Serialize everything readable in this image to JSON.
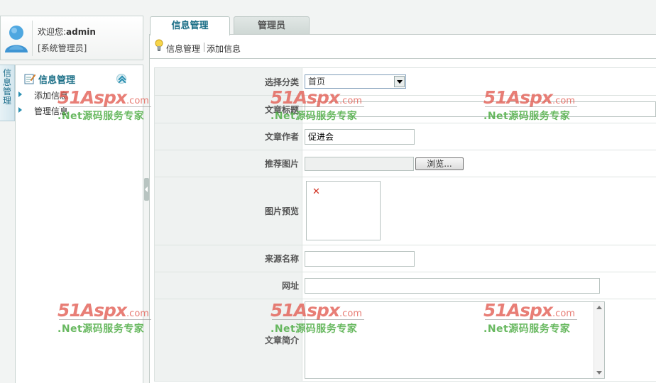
{
  "user": {
    "welcome_prefix": "欢迎您:",
    "username": "admin",
    "role": "[系统管理员]"
  },
  "tabs": [
    {
      "label": "信息管理",
      "active": true
    },
    {
      "label": "管理员",
      "active": false
    }
  ],
  "toolbar": {
    "links": [
      "信息管理",
      "添加信息"
    ]
  },
  "side_tab": {
    "label": "信息管理"
  },
  "menu": {
    "title": "信息管理",
    "items": [
      "添加信息",
      "管理信息"
    ]
  },
  "form": {
    "category": {
      "label": "选择分类",
      "value": "首页"
    },
    "title": {
      "label": "文章标题",
      "value": ""
    },
    "author": {
      "label": "文章作者",
      "value": "促进会"
    },
    "image": {
      "label": "推荐图片",
      "browse_label": "浏览..."
    },
    "preview": {
      "label": "图片预览"
    },
    "source": {
      "label": "来源名称",
      "value": ""
    },
    "url": {
      "label": "网址",
      "value": ""
    },
    "summary": {
      "label": "文章简介",
      "value": ""
    }
  },
  "watermark": {
    "brand": "51Aspx",
    "domain": ".com",
    "tagline": ".Net源码服务专家"
  },
  "colors": {
    "accent": "#1a6e86",
    "watermark_red": "#e25a50",
    "watermark_green": "#48aa3e"
  }
}
